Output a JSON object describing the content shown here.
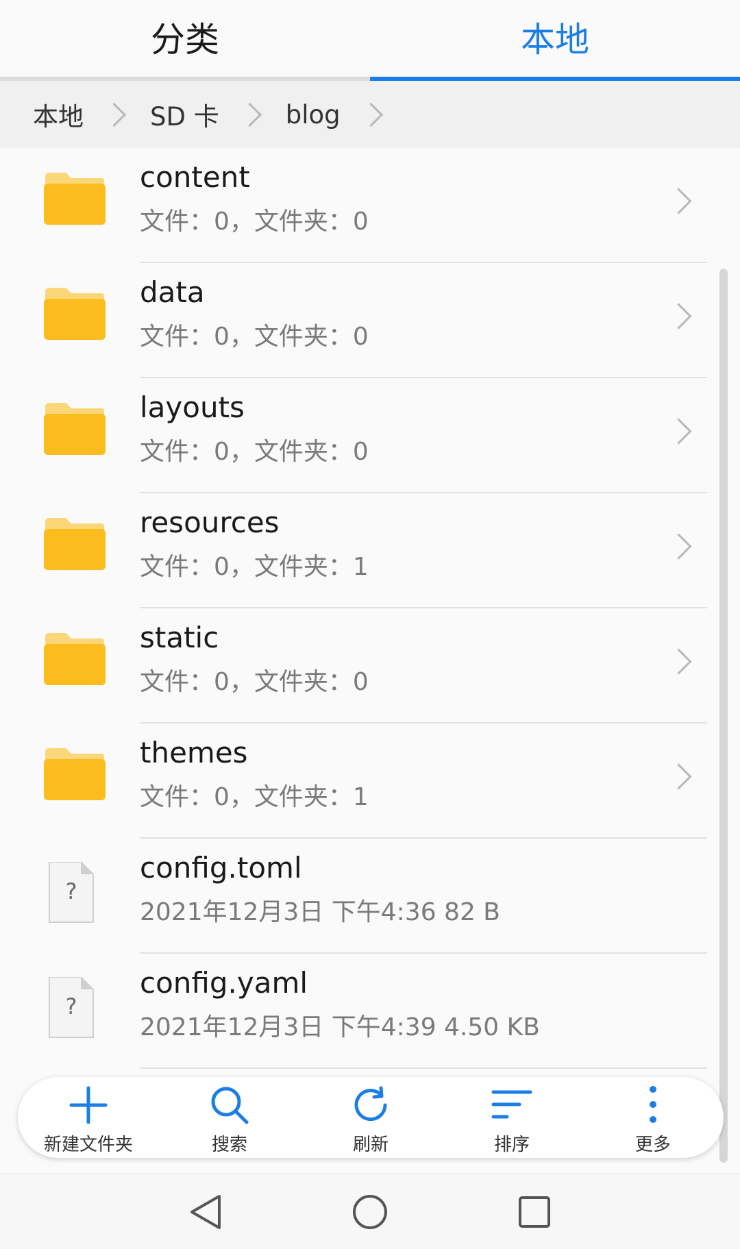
{
  "tabs": [
    {
      "label": "分类",
      "active": false
    },
    {
      "label": "本地",
      "active": true
    }
  ],
  "breadcrumb": [
    "本地",
    "SD 卡",
    "blog"
  ],
  "items": [
    {
      "type": "folder",
      "name": "content",
      "meta": "文件：0，文件夹：0"
    },
    {
      "type": "folder",
      "name": "data",
      "meta": "文件：0，文件夹：0"
    },
    {
      "type": "folder",
      "name": "layouts",
      "meta": "文件：0，文件夹：0"
    },
    {
      "type": "folder",
      "name": "resources",
      "meta": "文件：0，文件夹：1"
    },
    {
      "type": "folder",
      "name": "static",
      "meta": "文件：0，文件夹：0"
    },
    {
      "type": "folder",
      "name": "themes",
      "meta": "文件：0，文件夹：1"
    },
    {
      "type": "file",
      "name": "config.toml",
      "meta": "2021年12月3日 下午4:36 82 B"
    },
    {
      "type": "file",
      "name": "config.yaml",
      "meta": "2021年12月3日 下午4:39 4.50 KB"
    }
  ],
  "toolbar": {
    "new_folder": "新建文件夹",
    "search": "搜索",
    "refresh": "刷新",
    "sort": "排序",
    "more": "更多"
  },
  "colors": {
    "accent": "#1a7ee6",
    "folder": "#fbbc1e",
    "folder_tab": "#fcd77a"
  },
  "icons": {
    "folder": "folder-icon",
    "file": "unknown-file-icon",
    "chevron": "chevron-right-icon"
  }
}
